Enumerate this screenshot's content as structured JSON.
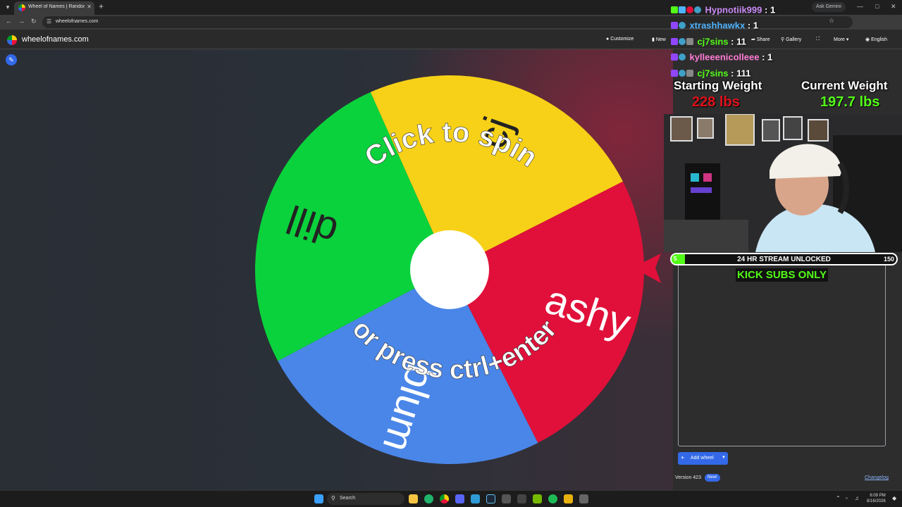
{
  "browser": {
    "tab_title": "Wheel of Names | Random nam",
    "url": "wheelofnames.com",
    "ask_gemini": "Ask Gemini"
  },
  "site": {
    "logo_text": "wheelofnames.com",
    "nav": {
      "customize": "Customize",
      "new": "New",
      "share": "Share",
      "gallery": "Gallery",
      "more": "More",
      "language": "English"
    }
  },
  "wheel": {
    "segments": [
      {
        "label": "cj",
        "color": "#f7d117",
        "text_color": "#222222"
      },
      {
        "label": "ashy",
        "color": "#e0103a",
        "text_color": "#ffffff"
      },
      {
        "label": "blum",
        "color": "#4a86e8",
        "text_color": "#ffffff"
      },
      {
        "label": "dill",
        "color": "#0ad23c",
        "text_color": "#222222"
      }
    ],
    "prompt_top": "Click to spin",
    "prompt_bottom": "or press ctrl+enter",
    "pointer_color": "#e0103a"
  },
  "panel": {
    "add_wheel": "Add wheel",
    "version": "Version 423",
    "new_badge": "New!",
    "changelog": "Changelog"
  },
  "chat": [
    {
      "user": "Hypnotiik999",
      "count": "1",
      "color": "#c98af5"
    },
    {
      "user": "xtrashhawkx",
      "count": "1",
      "color": "#4fb4ff"
    },
    {
      "user": "cj7sins",
      "count": "11",
      "color": "#53fc18"
    },
    {
      "user": "kylleeenicolleee",
      "count": "1",
      "color": "#ff7bd5"
    },
    {
      "user": "cj7sins",
      "count": "111",
      "color": "#53fc18"
    }
  ],
  "weight": {
    "starting_label": "Starting Weight",
    "starting_value": "228 lbs",
    "starting_color": "#e0101a",
    "current_label": "Current Weight",
    "current_value": "197.7 lbs",
    "current_color": "#53fc18"
  },
  "goal": {
    "current": "5",
    "title": "24 HR STREAM UNLOCKED",
    "target": "150",
    "progress": 0.033,
    "subtitle": "KICK SUBS ONLY",
    "color": "#53fc18"
  },
  "taskbar": {
    "search": "Search",
    "time": "6:09 PM",
    "date": "8/16/2026"
  }
}
